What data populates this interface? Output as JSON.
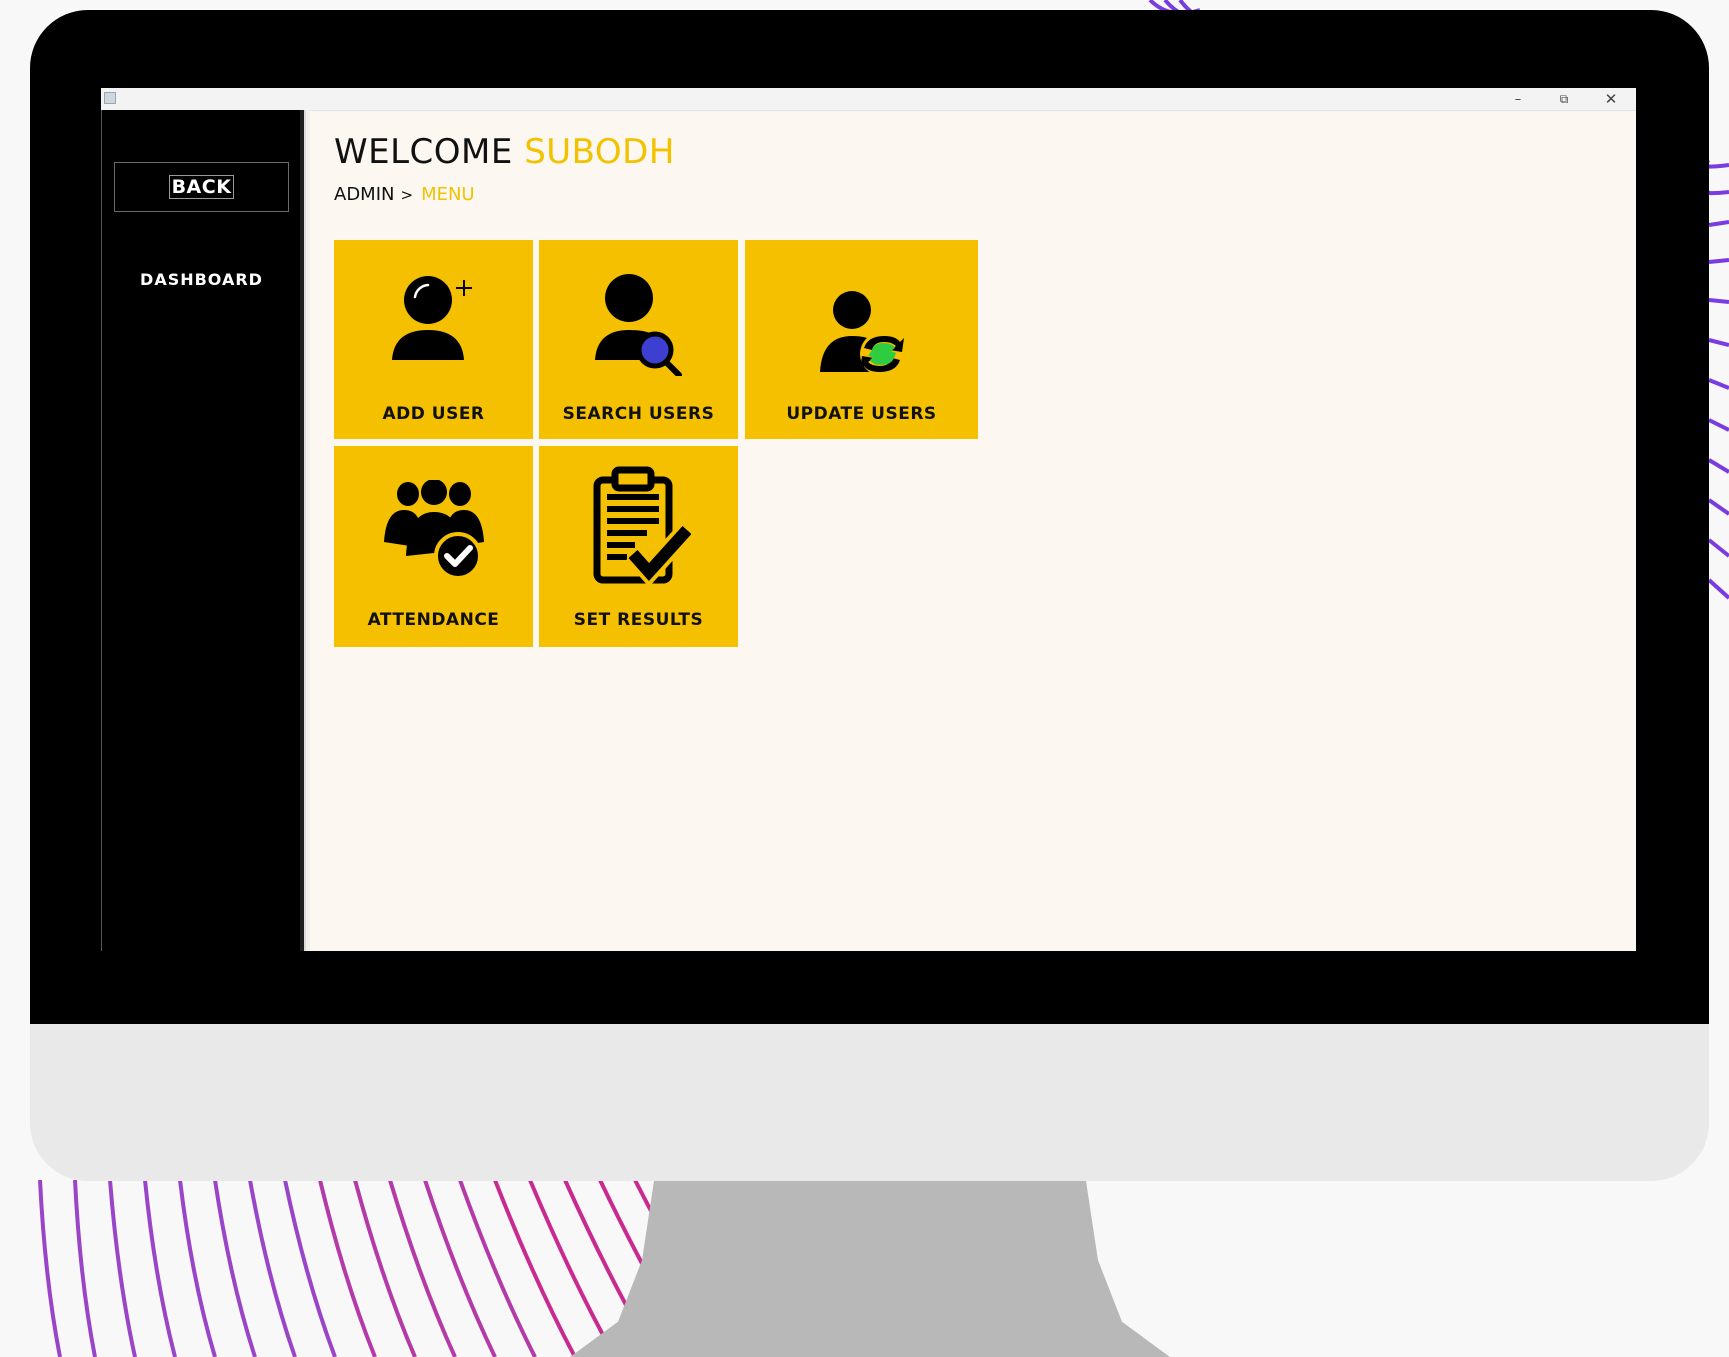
{
  "window": {
    "minimize_glyph": "–",
    "restore_glyph": "⧉",
    "close_glyph": "✕"
  },
  "sidebar": {
    "back_label": "BACK",
    "dashboard_label": "DASHBOARD"
  },
  "header": {
    "welcome_text": "WELCOME",
    "user_name": "SUBODH"
  },
  "breadcrumb": {
    "root": "ADMIN",
    "separator": ">",
    "current": "MENU"
  },
  "tiles": [
    {
      "label": "ADD USER",
      "icon": "add-user-icon"
    },
    {
      "label": "SEARCH USERS",
      "icon": "search-user-icon"
    },
    {
      "label": "UPDATE USERS",
      "icon": "update-user-icon"
    },
    {
      "label": "ATTENDANCE",
      "icon": "attendance-icon"
    },
    {
      "label": "SET RESULTS",
      "icon": "clipboard-check-icon"
    }
  ],
  "colors": {
    "accent": "#f5c000",
    "accent_text": "#f2c200",
    "sidebar_bg": "#000000",
    "content_bg": "#fcf8f1",
    "search_lens": "#3c3fcf",
    "update_badge": "#2ecc40"
  }
}
